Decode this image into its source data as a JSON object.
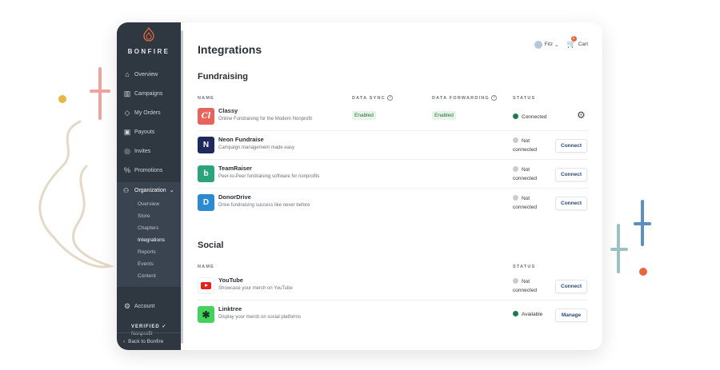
{
  "brand": {
    "name": "BONFIRE"
  },
  "sidebar": {
    "items": [
      {
        "label": "Overview",
        "icon": "home-icon"
      },
      {
        "label": "Campaigns",
        "icon": "bar-chart-icon"
      },
      {
        "label": "My Orders",
        "icon": "tag-icon"
      },
      {
        "label": "Payouts",
        "icon": "payouts-icon"
      },
      {
        "label": "Invites",
        "icon": "invites-icon"
      },
      {
        "label": "Promotions",
        "icon": "percent-icon"
      }
    ],
    "organization": {
      "label": "Organization",
      "icon": "users-icon",
      "sub_items": [
        "Overview",
        "Store",
        "Chapters",
        "Integrations",
        "Reports",
        "Events",
        "Content"
      ],
      "active": "Integrations"
    },
    "account": "Account",
    "verified": {
      "title": "VERIFIED",
      "subtitle": "Nonprofit"
    },
    "back": "Back to Bonfire"
  },
  "topbar": {
    "user": "Fitz",
    "cart": "Cart",
    "cart_count": "1"
  },
  "page_title": "Integrations",
  "fundraising": {
    "title": "Fundraising",
    "columns": {
      "name": "NAME",
      "data_sync": "DATA SYNC",
      "data_forwarding": "DATA FORWARDING",
      "status": "STATUS"
    },
    "rows": [
      {
        "name": "Classy",
        "desc": "Online Fundraising for the Modern Nonprofit",
        "data_sync": "Enabled",
        "data_forwarding": "Enabled",
        "status": "Connected",
        "status_color": "#1f7a4c",
        "action": "",
        "logo_color": "#e8645a",
        "logo_glyph": "Cl"
      },
      {
        "name": "Neon Fundraise",
        "desc": "Campaign management made easy",
        "status_line1": "Not",
        "status_line2": "connected",
        "status_color": "#c8ccd2",
        "action": "Connect",
        "logo_color": "#1f2a5c",
        "logo_glyph": "N"
      },
      {
        "name": "TeamRaiser",
        "desc": "Peer-to-Peer fundraising software for nonprofits",
        "status_line1": "Not",
        "status_line2": "connected",
        "status_color": "#c8ccd2",
        "action": "Connect",
        "logo_color": "#2ba37d",
        "logo_glyph": "b"
      },
      {
        "name": "DonorDrive",
        "desc": "Drive fundraising success like never before",
        "status_line1": "Not",
        "status_line2": "connected",
        "status_color": "#c8ccd2",
        "action": "Connect",
        "logo_color": "#2a8bd0",
        "logo_glyph": "D"
      }
    ]
  },
  "social": {
    "title": "Social",
    "columns": {
      "name": "NAME",
      "status": "STATUS"
    },
    "rows": [
      {
        "name": "YouTube",
        "desc": "Showcase your merch on YouTube",
        "status_line1": "Not",
        "status_line2": "connected",
        "status_color": "#c8ccd2",
        "action": "Connect",
        "logo_color": "#ffffff",
        "logo_glyph": "▶"
      },
      {
        "name": "Linktree",
        "desc": "Display your merch on social platforms",
        "status": "Available",
        "status_color": "#1f7a4c",
        "action": "Manage",
        "logo_color": "#43d25c",
        "logo_glyph": "✱"
      }
    ]
  },
  "colors": {
    "sidebar": "#2f3741",
    "accent": "#2c4a7b",
    "connected": "#1f7a4c"
  }
}
